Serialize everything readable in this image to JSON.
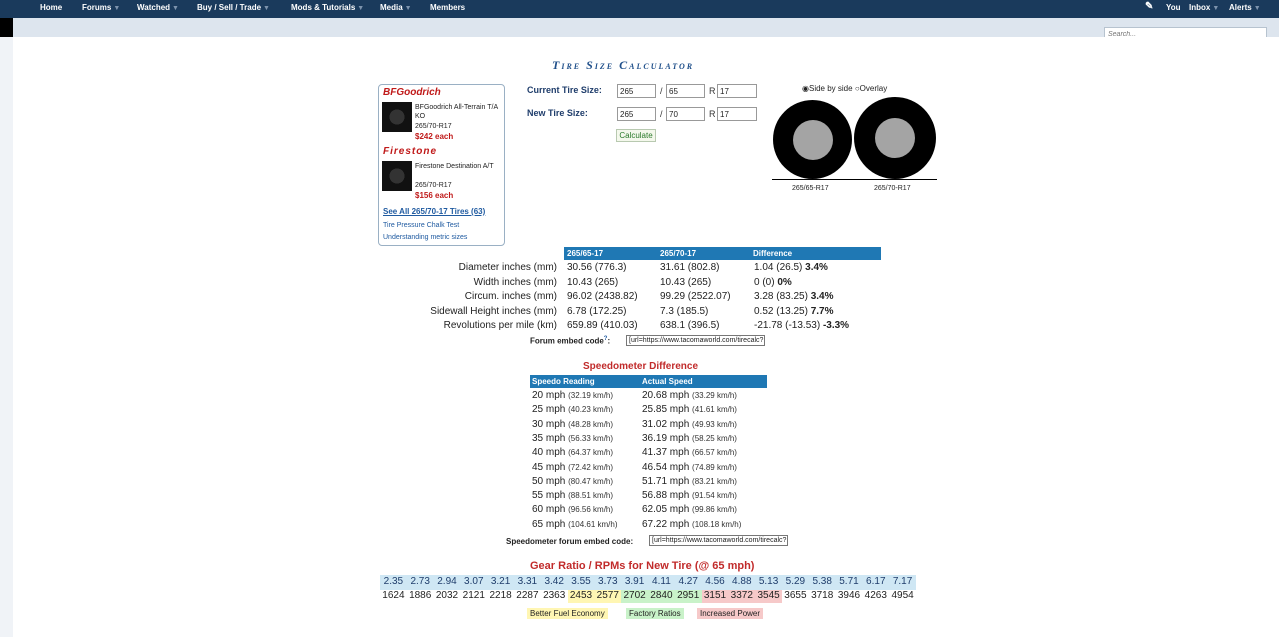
{
  "nav": {
    "items": [
      {
        "label": "Home",
        "caret": false
      },
      {
        "label": "Forums",
        "caret": true
      },
      {
        "label": "Watched",
        "caret": true
      },
      {
        "label": "Buy / Sell / Trade",
        "caret": true
      },
      {
        "label": "Mods & Tutorials",
        "caret": true
      },
      {
        "label": "Media",
        "caret": true
      },
      {
        "label": "Members",
        "caret": false
      }
    ],
    "right": {
      "you": "You",
      "inbox": "Inbox",
      "alerts": "Alerts"
    },
    "search_placeholder": "Search..."
  },
  "page_title": "Tire Size Calculator",
  "sidebar": {
    "brand1": "BFGoodrich",
    "tire1": {
      "name": "BFGoodrich All-Terrain T/A KO",
      "size": "265/70-R17",
      "price": "$242 each"
    },
    "brand2": "Firestone",
    "tire2": {
      "name": "Firestone Destination A/T",
      "size": "265/70-R17",
      "price": "$156 each"
    },
    "see_all": "See All 265/70-17 Tires (63)",
    "link1": "Tire Pressure Chalk Test",
    "link2": "Understanding metric sizes"
  },
  "form": {
    "current_label": "Current Tire Size:",
    "new_label": "New Tire Size:",
    "current": {
      "width": "265",
      "aspect": "65",
      "rim": "17"
    },
    "new": {
      "width": "265",
      "aspect": "70",
      "rim": "17"
    },
    "slash": "/",
    "r": "R",
    "calc_button": "Calculate"
  },
  "visual": {
    "opt_side": "Side by side",
    "opt_overlay": "Overlay",
    "label1": "265/65-R17",
    "label2": "265/70-R17"
  },
  "compare": {
    "headers": [
      "265/65-17",
      "265/70-17",
      "Difference"
    ],
    "rows": [
      {
        "label": "Diameter inches (mm)",
        "a": "30.56 (776.3)",
        "b": "31.61 (802.8)",
        "diff": "1.04 (26.5)",
        "pct": "3.4%"
      },
      {
        "label": "Width inches (mm)",
        "a": "10.43 (265)",
        "b": "10.43 (265)",
        "diff": "0 (0)",
        "pct": "0%"
      },
      {
        "label": "Circum. inches (mm)",
        "a": "96.02 (2438.82)",
        "b": "99.29 (2522.07)",
        "diff": "3.28 (83.25)",
        "pct": "3.4%"
      },
      {
        "label": "Sidewall Height inches (mm)",
        "a": "6.78 (172.25)",
        "b": "7.3 (185.5)",
        "diff": "0.52 (13.25)",
        "pct": "7.7%"
      },
      {
        "label": "Revolutions per mile (km)",
        "a": "659.89 (410.03)",
        "b": "638.1 (396.5)",
        "diff": "-21.78 (-13.53)",
        "pct": "-3.3%"
      }
    ],
    "embed_label": "Forum embed code",
    "embed_help": "?",
    "embed_colon": ":",
    "embed_value": "[url=https://www.tacomaworld.com/tirecalc?"
  },
  "speedo": {
    "title": "Speedometer Difference",
    "headers": [
      "Speedo Reading",
      "Actual Speed"
    ],
    "rows": [
      {
        "reading": "20 mph",
        "reading_kmh": "(32.19 km/h)",
        "actual": "20.68 mph",
        "actual_kmh": "(33.29 km/h)"
      },
      {
        "reading": "25 mph",
        "reading_kmh": "(40.23 km/h)",
        "actual": "25.85 mph",
        "actual_kmh": "(41.61 km/h)"
      },
      {
        "reading": "30 mph",
        "reading_kmh": "(48.28 km/h)",
        "actual": "31.02 mph",
        "actual_kmh": "(49.93 km/h)"
      },
      {
        "reading": "35 mph",
        "reading_kmh": "(56.33 km/h)",
        "actual": "36.19 mph",
        "actual_kmh": "(58.25 km/h)"
      },
      {
        "reading": "40 mph",
        "reading_kmh": "(64.37 km/h)",
        "actual": "41.37 mph",
        "actual_kmh": "(66.57 km/h)"
      },
      {
        "reading": "45 mph",
        "reading_kmh": "(72.42 km/h)",
        "actual": "46.54 mph",
        "actual_kmh": "(74.89 km/h)"
      },
      {
        "reading": "50 mph",
        "reading_kmh": "(80.47 km/h)",
        "actual": "51.71 mph",
        "actual_kmh": "(83.21 km/h)"
      },
      {
        "reading": "55 mph",
        "reading_kmh": "(88.51 km/h)",
        "actual": "56.88 mph",
        "actual_kmh": "(91.54 km/h)"
      },
      {
        "reading": "60 mph",
        "reading_kmh": "(96.56 km/h)",
        "actual": "62.05 mph",
        "actual_kmh": "(99.86 km/h)"
      },
      {
        "reading": "65 mph",
        "reading_kmh": "(104.61 km/h)",
        "actual": "67.22 mph",
        "actual_kmh": "(108.18 km/h)"
      }
    ],
    "embed_label": "Speedometer forum embed code:",
    "embed_value": "[url=https://www.tacomaworld.com/tirecalc?"
  },
  "gear": {
    "title": "Gear Ratio / RPMs for New Tire (@ 65 mph)",
    "ratios": [
      "2.35",
      "2.73",
      "2.94",
      "3.07",
      "3.21",
      "3.31",
      "3.42",
      "3.55",
      "3.73",
      "3.91",
      "4.11",
      "4.27",
      "4.56",
      "4.88",
      "5.13",
      "5.29",
      "5.38",
      "5.71",
      "6.17",
      "7.17"
    ],
    "rpms": [
      "1624",
      "1886",
      "2032",
      "2121",
      "2218",
      "2287",
      "2363",
      "2453",
      "2577",
      "2702",
      "2840",
      "2951",
      "3151",
      "3372",
      "3545",
      "3655",
      "3718",
      "3946",
      "4263",
      "4954"
    ],
    "highlights": [
      "",
      "",
      "",
      "",
      "",
      "",
      "",
      "yellow",
      "yellow",
      "green",
      "green",
      "green",
      "pink",
      "pink",
      "pink",
      "",
      "",
      "",
      "",
      ""
    ],
    "legend": [
      "Better Fuel Economy",
      "Factory Ratios",
      "Increased Power"
    ],
    "colors": {
      "yellow": "#fff6b3",
      "green": "#c9f2c9",
      "pink": "#f6c9c9"
    }
  }
}
